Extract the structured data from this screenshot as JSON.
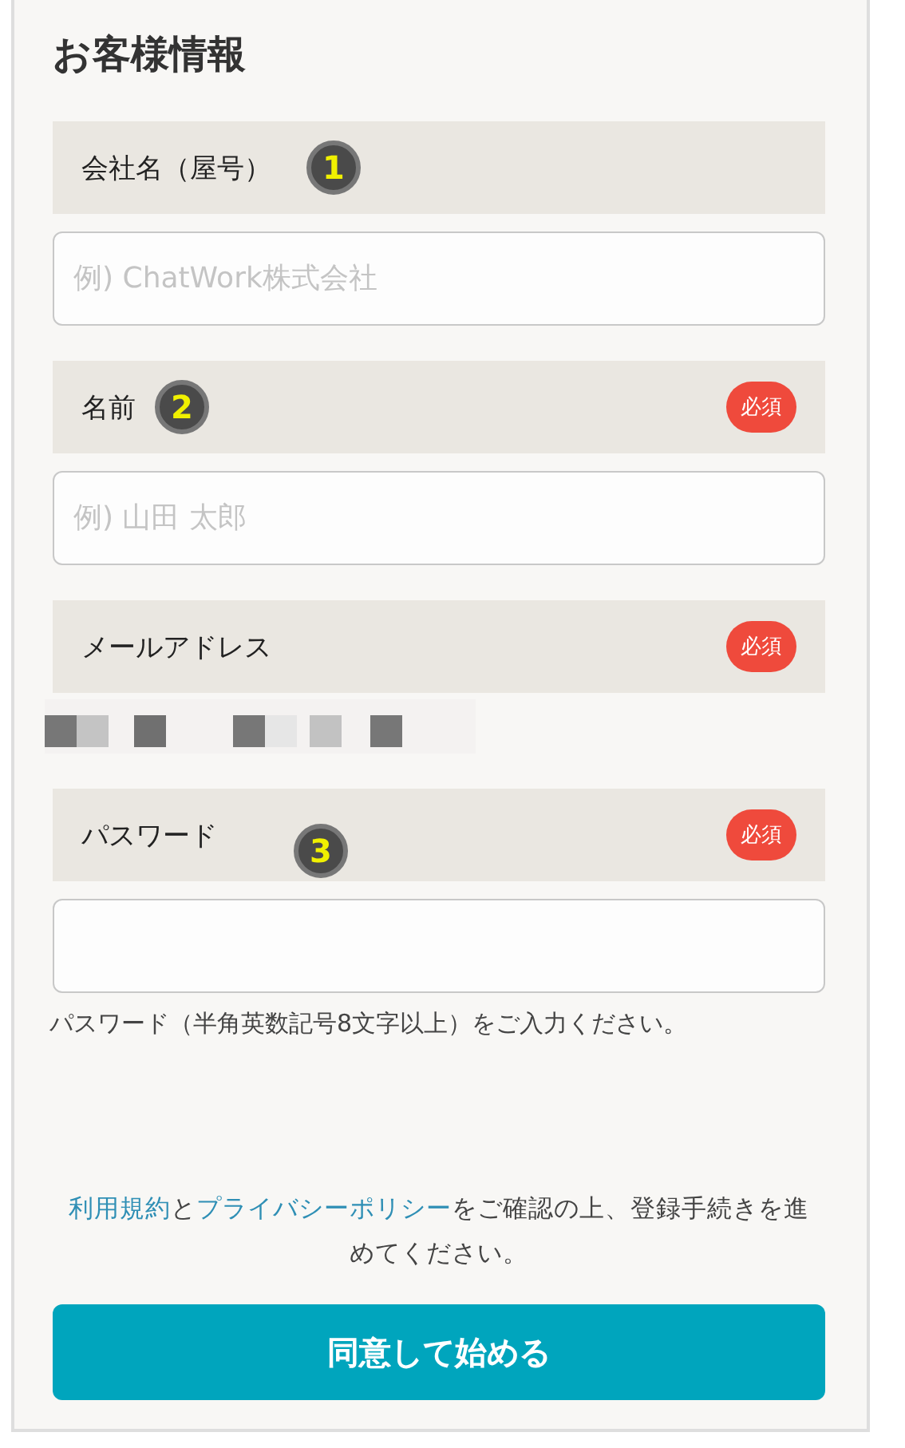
{
  "title": "お客様情報",
  "fields": [
    {
      "kind": "input",
      "label": "会社名（屋号）",
      "marker": "1",
      "required": false,
      "placeholder": "例) ChatWork株式会社"
    },
    {
      "kind": "input",
      "label": "名前",
      "marker": "2",
      "required": true,
      "required_label": "必須",
      "placeholder": "例) 山田 太郎"
    },
    {
      "kind": "redacted",
      "label": "メールアドレス",
      "required": true,
      "required_label": "必須"
    },
    {
      "kind": "input",
      "label": "パスワード",
      "marker": "3",
      "required": true,
      "required_label": "必須",
      "hint": "パスワード（半角英数記号8文字以上）をご入力ください。"
    }
  ],
  "terms": [
    {
      "text": "利用規約",
      "kind": "link"
    },
    {
      "text": "と",
      "kind": "text"
    },
    {
      "text": "プライバシーポリシー",
      "kind": "link"
    },
    {
      "text": "をご確認の上、登録手続きを進めてください。",
      "kind": "text"
    }
  ],
  "submit": "同意して始める"
}
